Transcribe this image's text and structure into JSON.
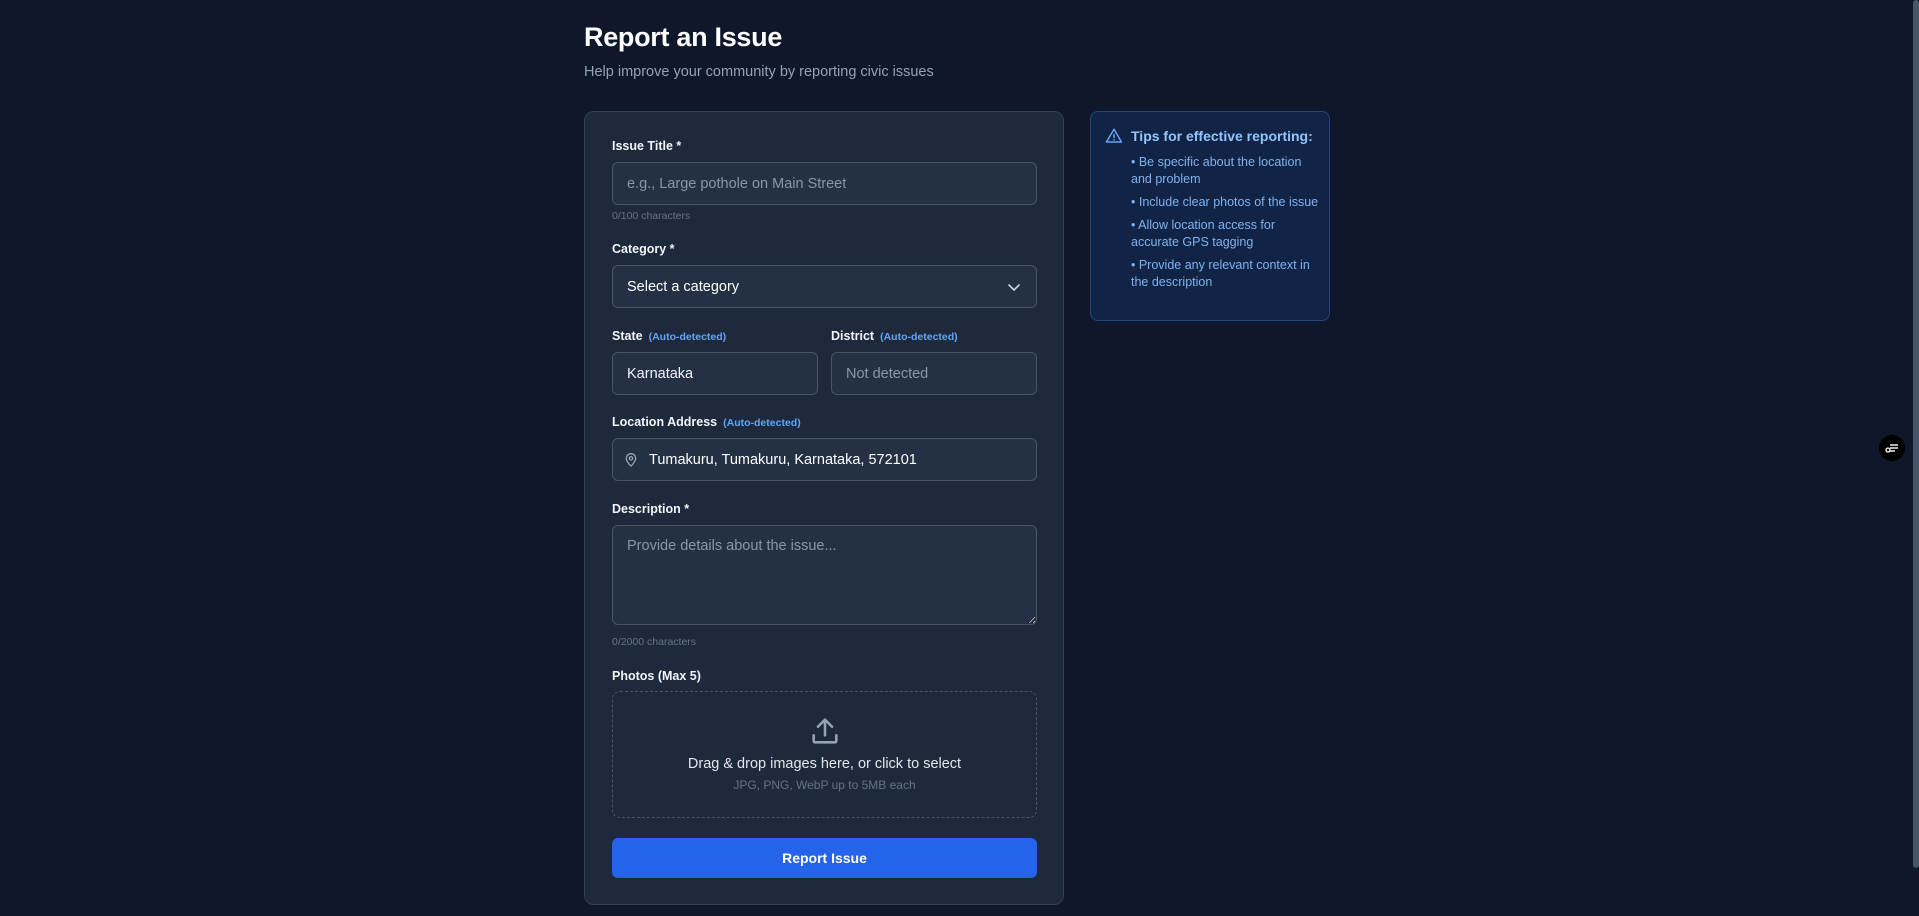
{
  "header": {
    "title": "Report an Issue",
    "subtitle": "Help improve your community by reporting civic issues"
  },
  "form": {
    "title_field": {
      "label": "Issue Title *",
      "placeholder": "e.g., Large pothole on Main Street",
      "value": "",
      "counter": "0/100 characters"
    },
    "category": {
      "label": "Category *",
      "selected": "Select a category"
    },
    "state": {
      "label": "State",
      "badge": "(Auto-detected)",
      "value": "Karnataka"
    },
    "district": {
      "label": "District",
      "badge": "(Auto-detected)",
      "placeholder": "Not detected",
      "value": ""
    },
    "location": {
      "label": "Location Address",
      "badge": "(Auto-detected)",
      "value": "Tumakuru, Tumakuru, Karnataka, 572101",
      "icon": "map-pin-icon"
    },
    "description": {
      "label": "Description *",
      "placeholder": "Provide details about the issue...",
      "value": "",
      "counter": "0/2000 characters"
    },
    "photos": {
      "label": "Photos (Max 5)",
      "drop_text": "Drag & drop images here, or click to select",
      "drop_hint": "JPG, PNG, WebP up to 5MB each",
      "icon": "upload-icon"
    },
    "submit_label": "Report Issue"
  },
  "tips": {
    "title": "Tips for effective reporting:",
    "icon": "warning-icon",
    "items": [
      "• Be specific about the location and problem",
      "• Include clear photos of the issue",
      "• Allow location access for accurate GPS tagging",
      "• Provide any relevant context in the description"
    ]
  },
  "colors": {
    "background": "#0f172a",
    "card": "#1e293b",
    "accent": "#2563eb",
    "auto_badge": "#60a5fa",
    "tips_bg": "#122445"
  }
}
